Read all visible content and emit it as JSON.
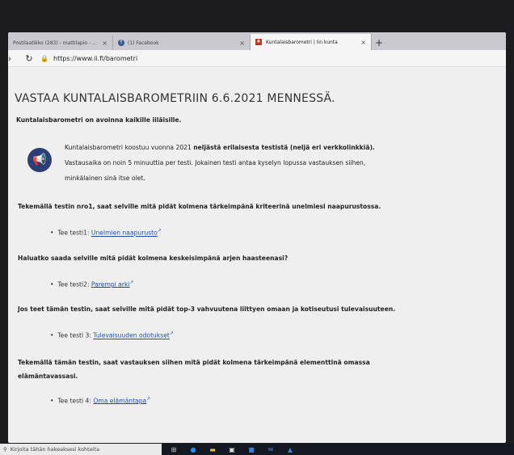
{
  "browser": {
    "tabs": [
      {
        "label": "Postilaatikko (283) - mattilapio - ...",
        "active": false
      },
      {
        "label": "(1) Facebook",
        "active": false
      },
      {
        "label": "Kuntalaisbarometri | Iin kunta",
        "active": true
      }
    ],
    "new_tab": "+",
    "url": "https://www.ii.fi/barometri"
  },
  "page": {
    "title": "VASTAA KUNTALAISBAROMETRIIN 6.6.2021 MENNESSÄ.",
    "intro": "Kuntalaisbarometri on avoinna kaikille iiläisille.",
    "info": {
      "line1_prefix": "Kuntalaisbarometri koostuu vuonna 2021 ",
      "line1_bold": "neljästä erilaisesta testistä (neljä eri verkkolinkkiä).",
      "line2": "Vastausaika on noin 5 minuuttia per testi. Jokainen testi antaa kyselyn lopussa vastauksen siihen,",
      "line3": "minkälainen sinä itse olet."
    },
    "q1": "Tekemällä testin nro1, saat selville mitä pidät kolmena tärkeimpänä kriteerinä unelmiesi naapurustossa.",
    "test1_prefix": "Tee testi1: ",
    "test1_link": "Unelmien naapurusto",
    "q2": "Haluatko saada selville mitä pidät kolmena keskeisimpänä arjen haasteenasi?",
    "test2_prefix": "Tee testi2: ",
    "test2_link": "Parempi arki",
    "q3": "Jos teet tämän testin, saat selville mitä pidät top-3 vahvuutena liittyen omaan ja kotiseutusi tulevaisuuteen.",
    "test3_prefix": "Tee testi 3: ",
    "test3_link": "Tulevaisuuden odotukset",
    "q4_line1": "Tekemällä tämän testin, saat vastauksen siihen mitä pidät kolmena tärkeimpänä elementtinä omassa",
    "q4_line2": "elämäntavassasi.",
    "test4_prefix": "Tee testi 4: ",
    "test4_link": "Oma elämäntapa"
  },
  "taskbar": {
    "search_placeholder": "Kirjoita tähän hakeaksesi kohteita"
  },
  "colors": {
    "link": "#1f4fa8",
    "megaphone_bg": "#2c3e74"
  }
}
